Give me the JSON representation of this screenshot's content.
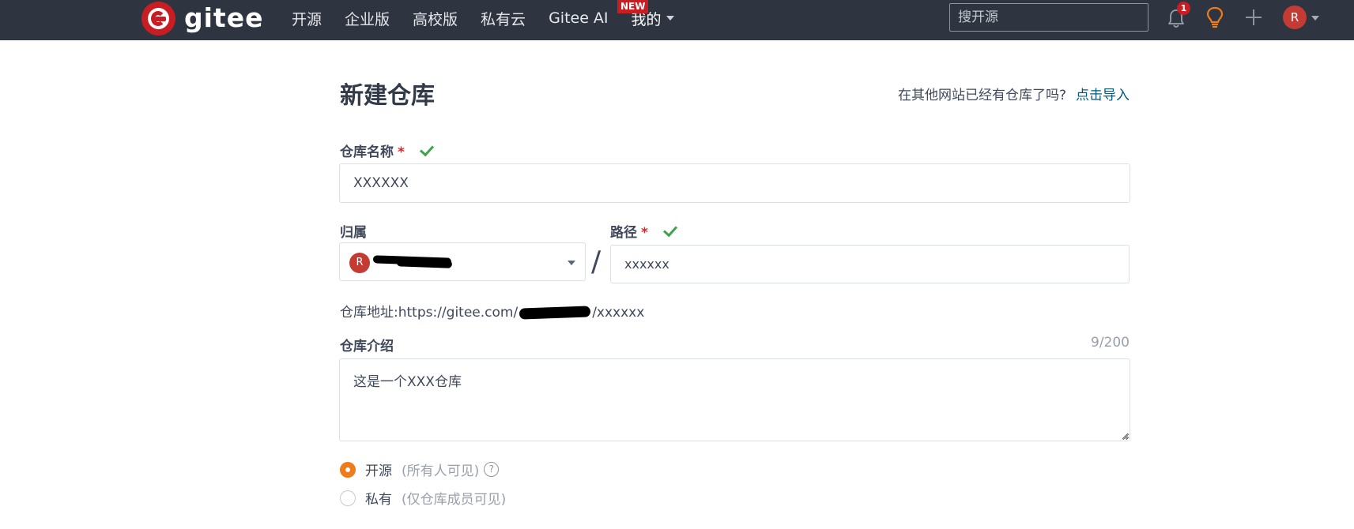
{
  "nav": {
    "logo_text": "gitee",
    "items": [
      "开源",
      "企业版",
      "高校版",
      "私有云",
      "Gitee AI"
    ],
    "new_badge": "NEW",
    "mine_label": "我的",
    "search_placeholder": "搜开源",
    "notification_count": "1",
    "user_initial": "R"
  },
  "page": {
    "title": "新建仓库",
    "import_hint": "在其他网站已经有仓库了吗?",
    "import_link": "点击导入"
  },
  "form": {
    "repo_name_label": "仓库名称",
    "required_mark": "*",
    "repo_name_value": "XXXXXX",
    "owner_label": "归属",
    "owner_avatar_initial": "R",
    "path_label": "路径",
    "path_value": "xxxxxx",
    "separator": "/",
    "url_prefix": "仓库地址:https://gitee.com/",
    "url_suffix": "/xxxxxx",
    "description_label": "仓库介绍",
    "description_counter": "9/200",
    "description_value": "这是一个XXX仓库",
    "visibility": [
      {
        "label": "开源",
        "hint": "(所有人可见)",
        "selected": true,
        "help": "?"
      },
      {
        "label": "私有",
        "hint": "(仅仓库成员可见)",
        "selected": false
      }
    ]
  },
  "colors": {
    "topbar": "#2e3440",
    "brand_red": "#c71d23",
    "link": "#005980",
    "check_green": "#3fa34d",
    "radio_orange": "#ef7c1a"
  }
}
